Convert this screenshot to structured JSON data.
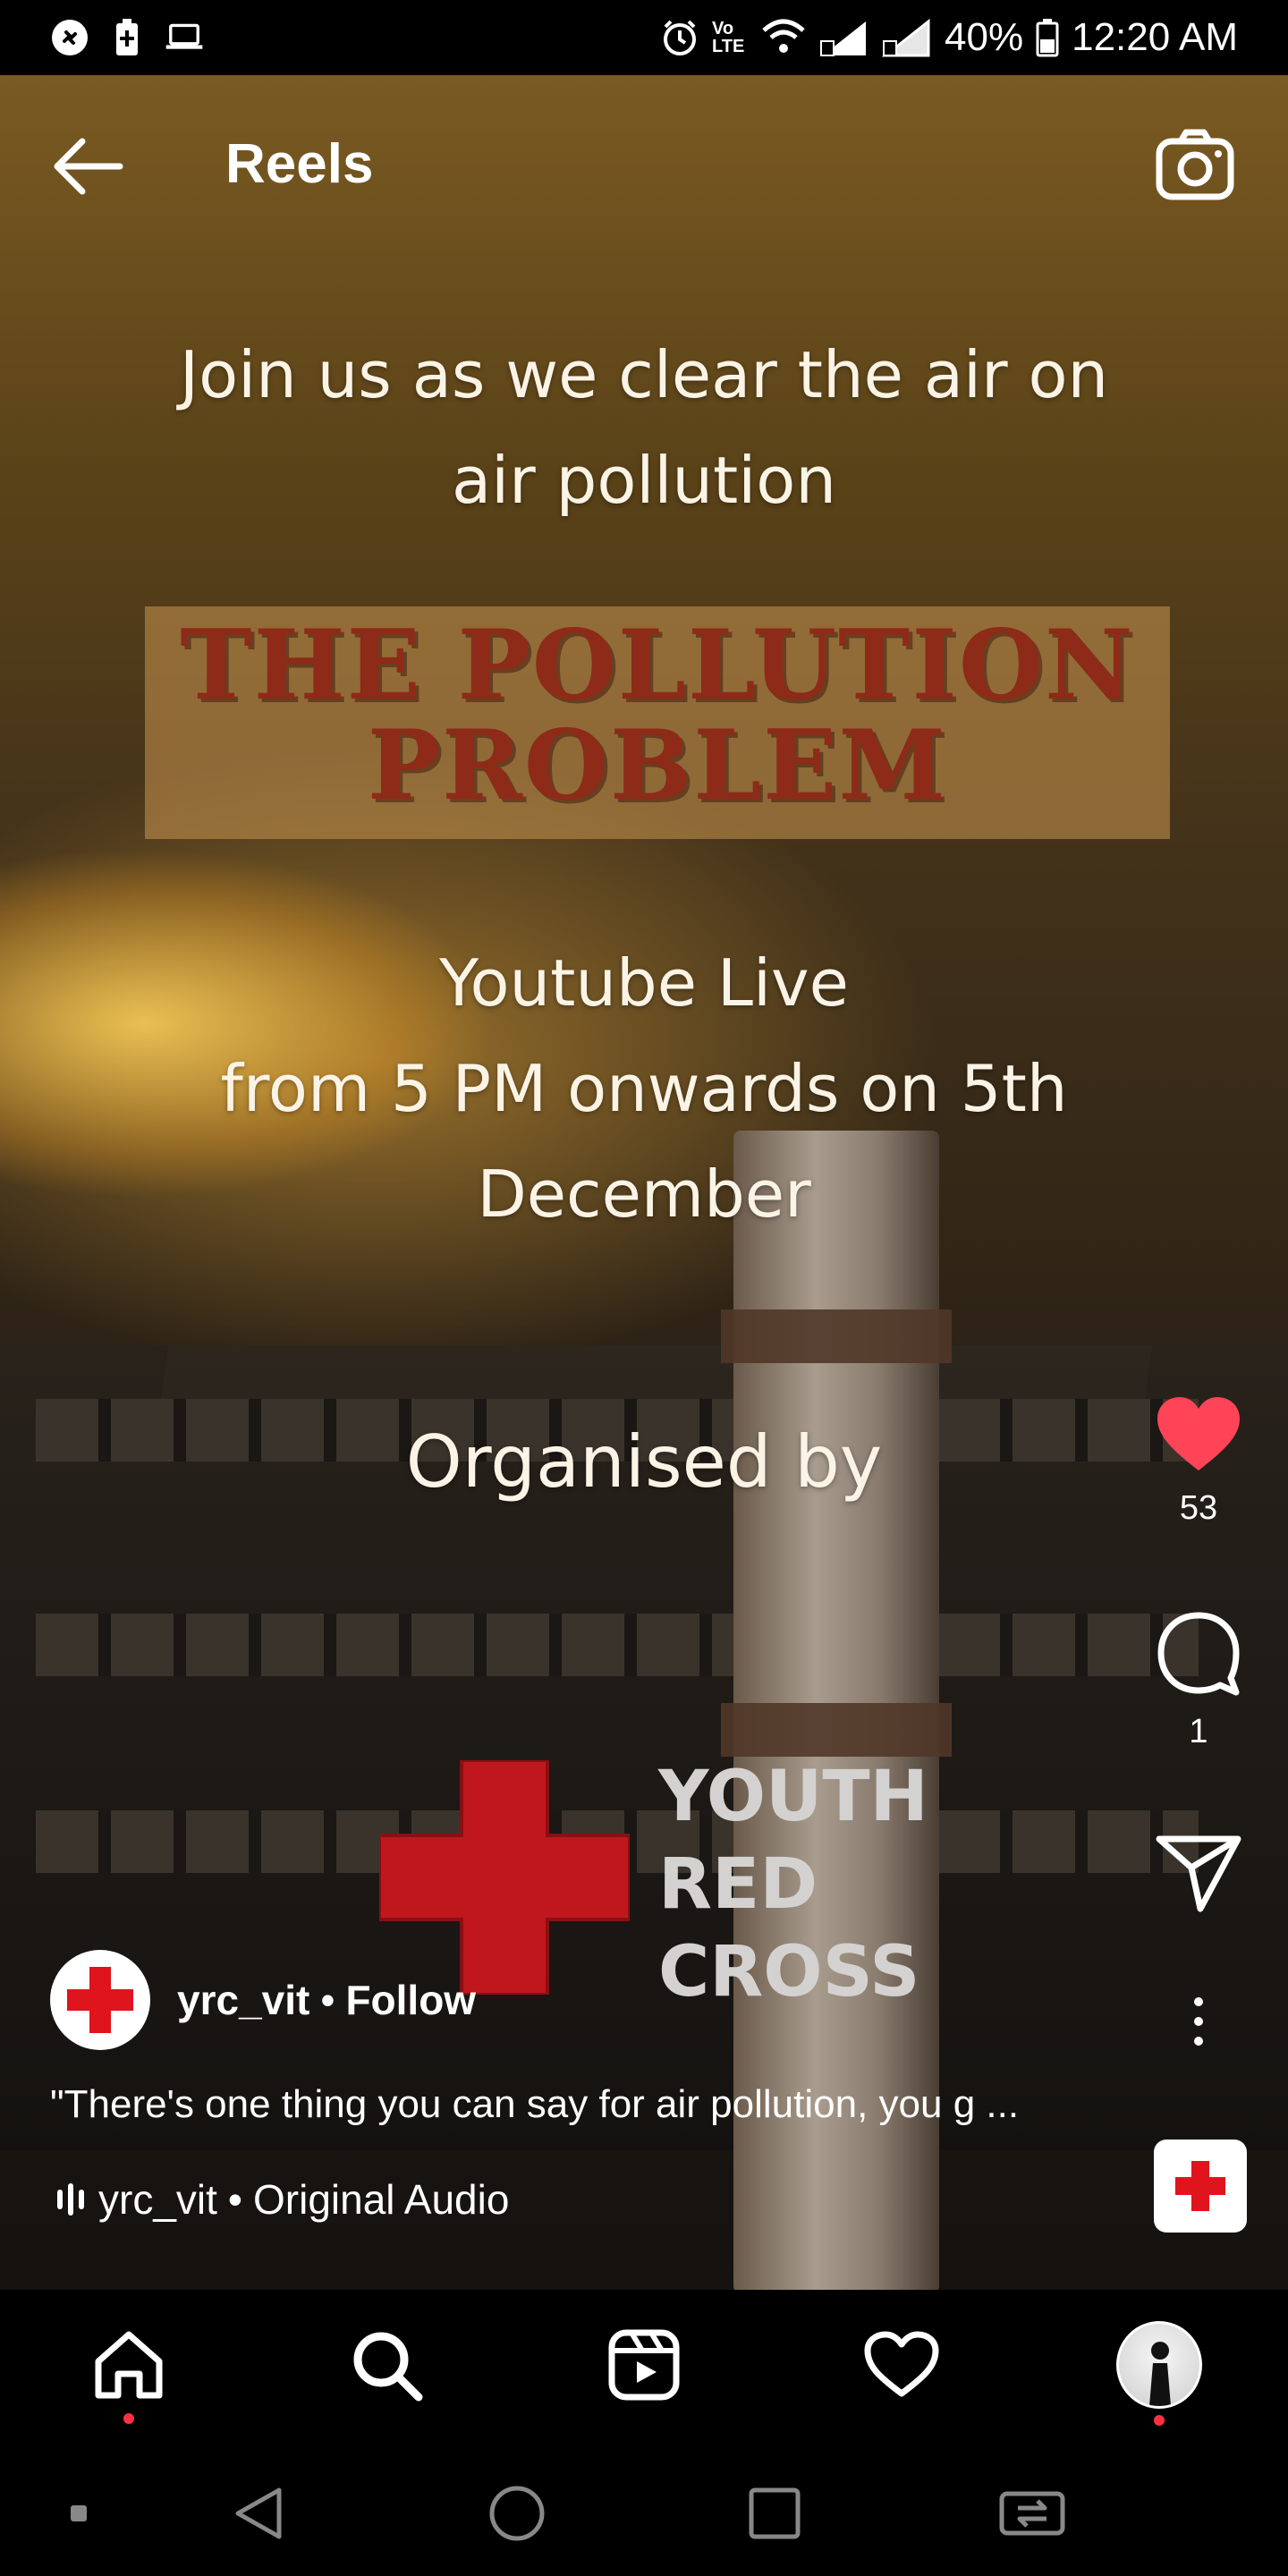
{
  "status_bar": {
    "left_icons": [
      "shazam-icon",
      "battery-saver-icon",
      "laptop-icon"
    ],
    "right_icons": [
      "alarm-icon",
      "volte-icon",
      "wifi-icon",
      "signal-sim1-icon",
      "signal-sim2-icon"
    ],
    "volte_label": "Vo LTE",
    "battery": "40%",
    "time": "12:20 AM"
  },
  "header": {
    "title": "Reels",
    "back_icon": "arrow-left-icon",
    "camera_icon": "camera-icon"
  },
  "video": {
    "join_line1": "Join us as we clear the air on",
    "join_line2": "air pollution",
    "poll_line1": "THE POLLUTION",
    "poll_line2": "PROBLEM",
    "live_line1": "Youtube Live",
    "live_line2": "from 5 PM onwards on 5th",
    "live_line3": "December",
    "organised": "Organised by",
    "logo_line1": "YOUTH",
    "logo_line2": "RED",
    "logo_line3": "CROSS"
  },
  "actions": {
    "like_count": "53",
    "comment_count": "1",
    "colors": {
      "like": "#ff4458"
    }
  },
  "post": {
    "author": "yrc_vit",
    "separator": "•",
    "follow_label": "Follow",
    "caption": "\"There's one thing you can say for air pollution, you g ...",
    "audio_author": "yrc_vit",
    "audio_title": "Original Audio"
  },
  "nav": {
    "items": [
      "home-icon",
      "search-icon",
      "reels-icon",
      "heart-icon",
      "profile-avatar"
    ]
  },
  "system_nav": {
    "items": [
      "dot-icon",
      "back-triangle-icon",
      "home-circle-icon",
      "recents-square-icon",
      "screen-switch-icon"
    ]
  }
}
